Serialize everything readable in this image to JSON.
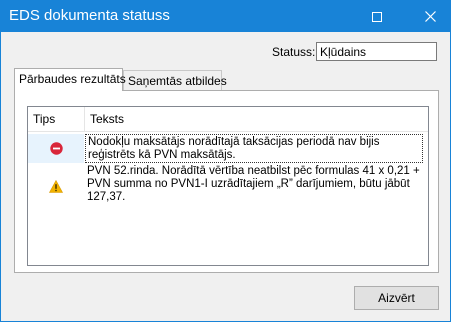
{
  "window": {
    "title": "EDS dokumenta statuss",
    "title_bar_color": "#1883d7"
  },
  "status": {
    "label": "Statuss:",
    "value": "Kļūdains"
  },
  "tabs": [
    {
      "label": "Pārbaudes rezultāts",
      "active": true
    },
    {
      "label": "Saņemtās atbildes",
      "active": false
    }
  ],
  "grid": {
    "columns": {
      "tips": "Tips",
      "teksts": "Teksts"
    },
    "rows": [
      {
        "type_icon": "error-icon",
        "selected": true,
        "text": "Nodokļu maksātājs norādītajā taksācijas periodā nav bijis reģistrēts kā PVN maksātājs."
      },
      {
        "type_icon": "warning-icon",
        "selected": false,
        "text": "PVN 52.rinda. Norādītā vērtība neatbilst pēc formulas 41 x 0,21 + PVN summa no PVN1-I uzrādītajiem „R” darījumiem, būtu jābūt 127,37."
      }
    ]
  },
  "buttons": {
    "close_label": "Aizvērt"
  },
  "colors": {
    "error": "#d9263a",
    "warning": "#f2b300"
  }
}
